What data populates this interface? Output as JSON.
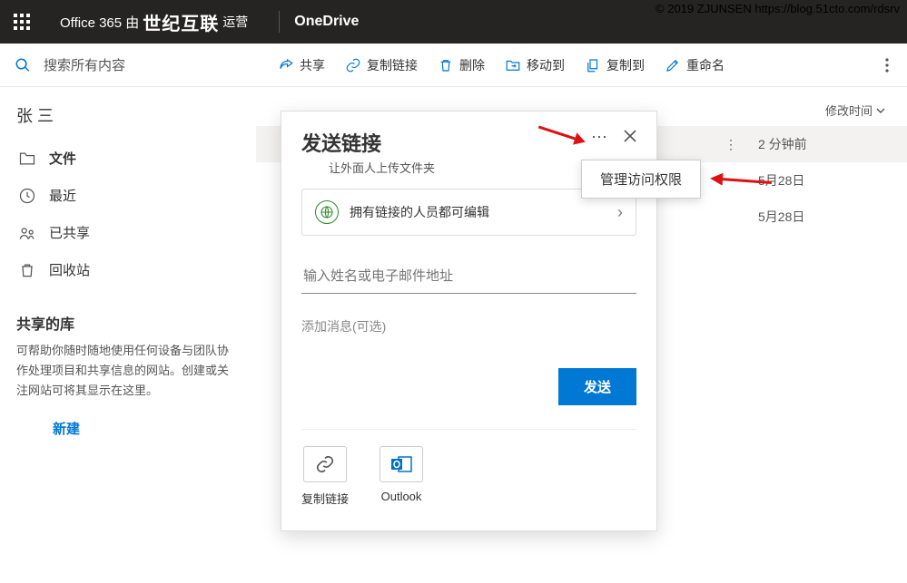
{
  "watermark": "© 2019 ZJUNSEN https://blog.51cto.com/rdsrv",
  "header": {
    "brand_prefix": "Office 365 由",
    "brand_operator": "世纪互联",
    "brand_suffix": "运营",
    "app": "OneDrive"
  },
  "search": {
    "placeholder": "搜索所有内容"
  },
  "user": "张 三",
  "nav": [
    {
      "label": "文件",
      "active": true,
      "icon": "folder"
    },
    {
      "label": "最近",
      "active": false,
      "icon": "recent"
    },
    {
      "label": "已共享",
      "active": false,
      "icon": "shared"
    },
    {
      "label": "回收站",
      "active": false,
      "icon": "recycle"
    }
  ],
  "library": {
    "title": "共享的库",
    "desc": "可帮助你随时随地使用任何设备与团队协作处理项目和共享信息的网站。创建或关注网站可将其显示在这里。",
    "new": "新建"
  },
  "toolbar": {
    "share": "共享",
    "copylink": "复制链接",
    "delete": "删除",
    "moveto": "移动到",
    "copyto": "复制到",
    "rename": "重命名"
  },
  "columns": {
    "modified": "修改时间"
  },
  "rows": [
    {
      "date": "2 分钟前",
      "selected": true
    },
    {
      "date": "5月28日",
      "selected": false
    },
    {
      "date": "5月28日",
      "selected": false
    }
  ],
  "dialog": {
    "title": "发送链接",
    "subtitle": "让外面人上传文件夹",
    "permission": "拥有链接的人员都可编辑",
    "name_placeholder": "输入姓名或电子邮件地址",
    "msg_placeholder": "添加消息(可选)",
    "send": "发送",
    "copy_link": "复制链接",
    "outlook": "Outlook"
  },
  "tooltip": "管理访问权限"
}
